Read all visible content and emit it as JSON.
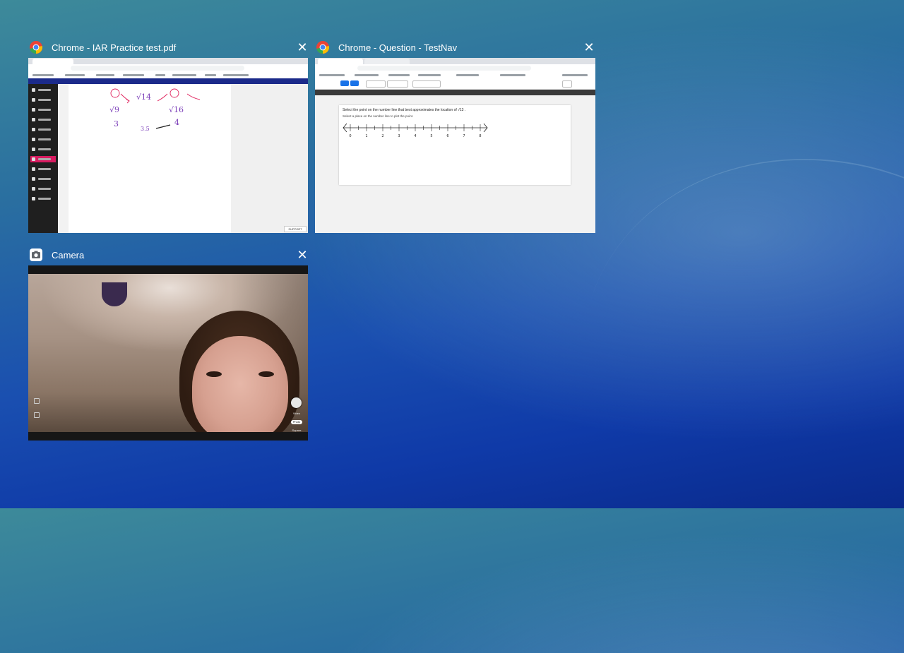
{
  "windows": [
    {
      "title": "Chrome - IAR Practice test.pdf",
      "icon": "chrome-icon",
      "close_label": "✕",
      "support_label": "SUPPORT",
      "math_labels": [
        "√9",
        "√14",
        "√16",
        "3",
        "3.5",
        "4"
      ]
    },
    {
      "title": "Chrome - Question - TestNav",
      "icon": "chrome-icon",
      "close_label": "✕",
      "question_text": "Select the point on the number line that best approximates the location of √13 .",
      "instruction_text": "Select a place on the number line to plot the point.",
      "number_line_labels": [
        "0",
        "1",
        "2",
        "3",
        "4",
        "5",
        "6",
        "7",
        "8"
      ]
    },
    {
      "title": "Camera",
      "icon": "camera-icon",
      "close_label": "✕",
      "modes": [
        "Video",
        "Photo",
        "Square"
      ]
    }
  ],
  "colors": {
    "chrome_red": "#ea4335",
    "chrome_green": "#34a853",
    "chrome_yellow": "#fbbc05",
    "chrome_blue": "#4285f4",
    "kami_active": "#d81b60",
    "kami_toolbar": "#1b2a8a",
    "testnav_button": "#1a73e8"
  }
}
